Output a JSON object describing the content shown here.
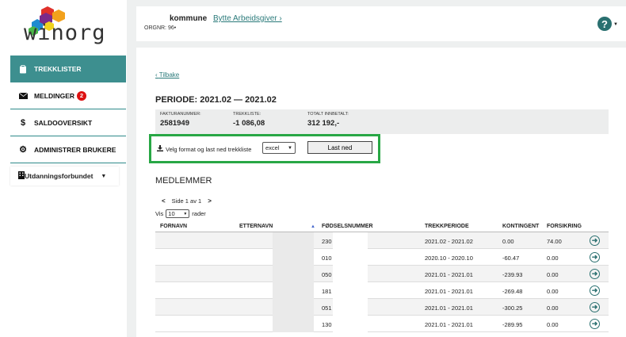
{
  "logo": {
    "text": "winorg",
    "colors": [
      "#e0312b",
      "#f2a11c",
      "#1e8bd1",
      "#7b2a8a",
      "#4ab848",
      "#f0d21c"
    ]
  },
  "sidebar": {
    "items": [
      {
        "label": "TREKKLISTER",
        "icon": "clipboard-icon",
        "active": true
      },
      {
        "label": "MELDINGER",
        "icon": "envelope-icon",
        "badge": "2"
      },
      {
        "label": "SALDOOVERSIKT",
        "icon": "dollar-icon"
      },
      {
        "label": "ADMINISTRER BRUKERE",
        "icon": "gear-icon"
      }
    ],
    "org_select": {
      "label": "Utdanningsforbundet",
      "icon": "building-icon"
    }
  },
  "header": {
    "kommune": "kommune",
    "bytte_link": "Bytte Arbeidsgiver",
    "orgnr": "ORGNR: 96•",
    "help_icon": "question-icon"
  },
  "main": {
    "back_link": "Tilbake",
    "periode_title": "PERIODE: 2021.02 — 2021.02",
    "summary": [
      {
        "label": "FAKTURANUMMER:",
        "value": "2581949"
      },
      {
        "label": "TREKKLISTE:",
        "value": "-1 086,08"
      },
      {
        "label": "TOTALT INNBETALT:",
        "value": "312 192,-"
      }
    ],
    "download": {
      "label": "Velg format og last ned trekkliste",
      "format_value": "excel",
      "button_label": "Last ned"
    },
    "members_title": "MEDLEMMER",
    "pager": {
      "prev": "<",
      "text": "Side 1 av 1",
      "next": ">"
    },
    "page_size": {
      "prefix": "Vis",
      "value": "10",
      "suffix": "rader"
    },
    "table": {
      "headers": [
        "FORNAVN",
        "ETTERNAVN",
        "FØDSELSNUMMER",
        "TREKKPERIODE",
        "KONTINGENT",
        "FORSIKRING"
      ],
      "rows": [
        {
          "fnr": "230",
          "periode": "2021.02 - 2021.02",
          "kontingent": "0.00",
          "forsikring": "74.00"
        },
        {
          "fnr": "010",
          "periode": "2020.10 - 2020.10",
          "kontingent": "-60.47",
          "forsikring": "0.00"
        },
        {
          "fnr": "050",
          "periode": "2021.01 - 2021.01",
          "kontingent": "-239.93",
          "forsikring": "0.00"
        },
        {
          "fnr": "181",
          "periode": "2021.01 - 2021.01",
          "kontingent": "-269.48",
          "forsikring": "0.00"
        },
        {
          "fnr": "051",
          "periode": "2021.01 - 2021.01",
          "kontingent": "-300.25",
          "forsikring": "0.00"
        },
        {
          "fnr": "130",
          "periode": "2021.01 - 2021.01",
          "kontingent": "-289.95",
          "forsikring": "0.00"
        }
      ]
    }
  }
}
